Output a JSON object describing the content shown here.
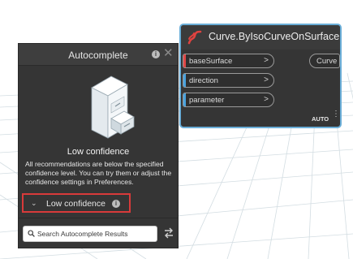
{
  "autocomplete": {
    "title": "Autocomplete",
    "confidence_title": "Low confidence",
    "description": "All recommendations are below the specified confidence level. You can try them or adjust the confidence settings in Preferences.",
    "dropdown_label": "Low confidence",
    "search_placeholder": "Search Autocomplete Results"
  },
  "node": {
    "title": "Curve.ByIsoCurveOnSurface",
    "inputs": [
      {
        "label": "baseSurface",
        "arrow": ">",
        "color": "#e04848"
      },
      {
        "label": "direction",
        "arrow": ">",
        "color": "#4aa3df"
      },
      {
        "label": "parameter",
        "arrow": ">",
        "color": "#4aa3df"
      }
    ],
    "output": "Curve",
    "lacing": "AUTO"
  },
  "icons": {
    "info": "i",
    "close": "✕",
    "chevron": "⌄",
    "more": "⋮"
  }
}
